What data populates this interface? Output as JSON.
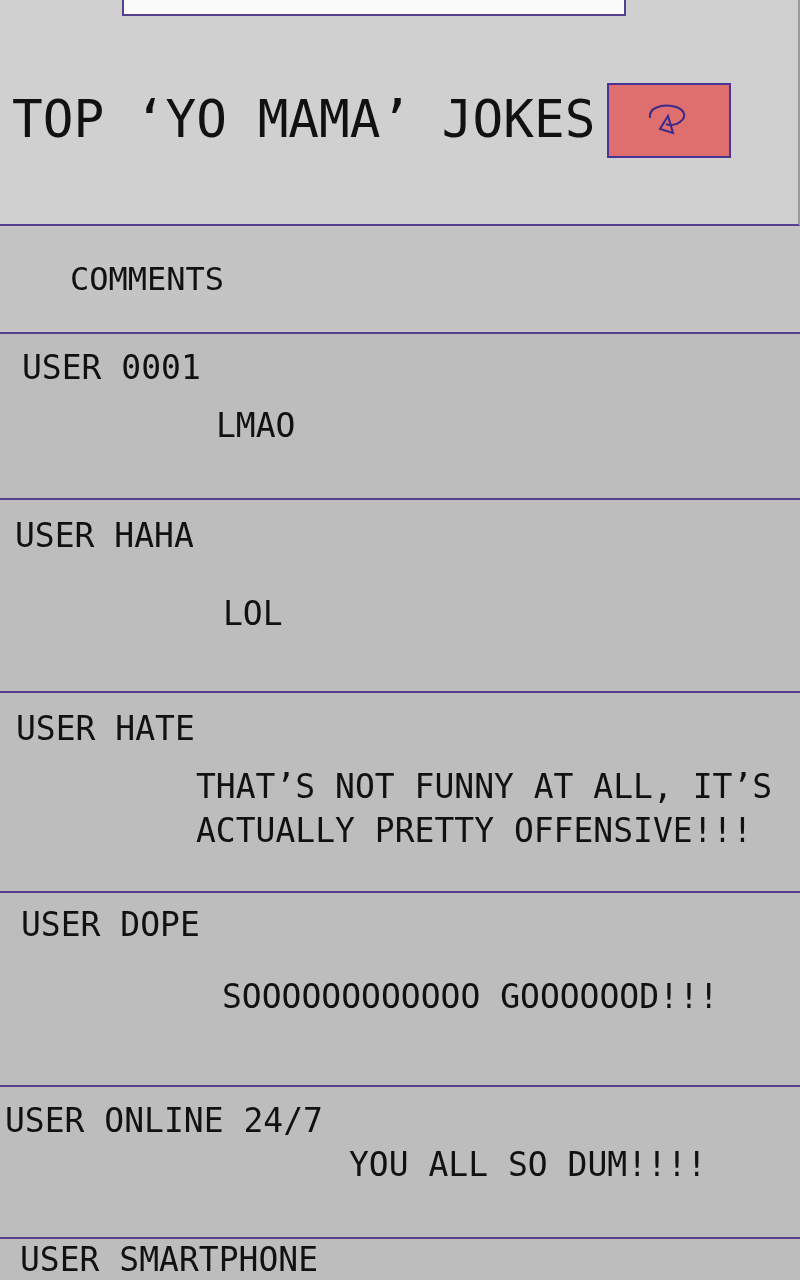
{
  "header": {
    "title": "TOP ‘YO MAMA’ JOKES"
  },
  "comments_header": {
    "label": "COMMENTS"
  },
  "comments": [
    {
      "user": "USER 0001",
      "text": "LMAO"
    },
    {
      "user": "USER HAHA",
      "text": "LOL"
    },
    {
      "user": "USER HATE",
      "text": "THAT’S NOT FUNNY AT ALL, IT’S ACTUALLY PRETTY OFFENSIVE!!!"
    },
    {
      "user": "USER DOPE",
      "text": "SOOOOOOOOOOOO GOOOOOOD!!!"
    },
    {
      "user": "USER ONLINE 24/7",
      "text": "YOU ALL SO DUM!!!!"
    },
    {
      "user": "USER SMARTPHONE"
    }
  ]
}
